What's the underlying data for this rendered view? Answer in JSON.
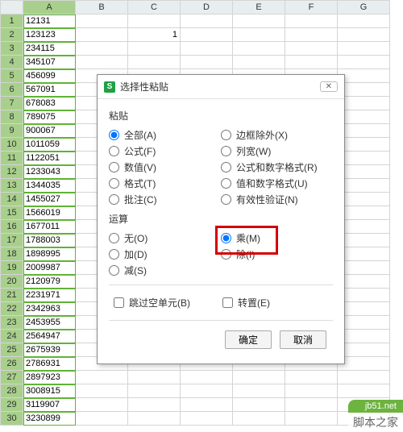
{
  "columns": [
    "A",
    "B",
    "C",
    "D",
    "E",
    "F",
    "G"
  ],
  "rows": [
    {
      "n": 1,
      "a": "12131"
    },
    {
      "n": 2,
      "a": "123123",
      "c": "1"
    },
    {
      "n": 3,
      "a": "234115"
    },
    {
      "n": 4,
      "a": "345107"
    },
    {
      "n": 5,
      "a": "456099"
    },
    {
      "n": 6,
      "a": "567091"
    },
    {
      "n": 7,
      "a": "678083"
    },
    {
      "n": 8,
      "a": "789075"
    },
    {
      "n": 9,
      "a": "900067"
    },
    {
      "n": 10,
      "a": "1011059"
    },
    {
      "n": 11,
      "a": "1122051"
    },
    {
      "n": 12,
      "a": "1233043"
    },
    {
      "n": 13,
      "a": "1344035"
    },
    {
      "n": 14,
      "a": "1455027"
    },
    {
      "n": 15,
      "a": "1566019"
    },
    {
      "n": 16,
      "a": "1677011"
    },
    {
      "n": 17,
      "a": "1788003"
    },
    {
      "n": 18,
      "a": "1898995"
    },
    {
      "n": 19,
      "a": "2009987"
    },
    {
      "n": 20,
      "a": "2120979"
    },
    {
      "n": 21,
      "a": "2231971"
    },
    {
      "n": 22,
      "a": "2342963"
    },
    {
      "n": 23,
      "a": "2453955"
    },
    {
      "n": 24,
      "a": "2564947"
    },
    {
      "n": 25,
      "a": "2675939"
    },
    {
      "n": 26,
      "a": "2786931"
    },
    {
      "n": 27,
      "a": "2897923"
    },
    {
      "n": 28,
      "a": "3008915"
    },
    {
      "n": 29,
      "a": "3119907"
    },
    {
      "n": 30,
      "a": "3230899"
    }
  ],
  "dialog": {
    "title": "选择性粘贴",
    "group_paste": "粘贴",
    "paste_left": [
      {
        "label": "全部(A)",
        "checked": true
      },
      {
        "label": "公式(F)"
      },
      {
        "label": "数值(V)"
      },
      {
        "label": "格式(T)"
      },
      {
        "label": "批注(C)"
      }
    ],
    "paste_right": [
      {
        "label": "边框除外(X)"
      },
      {
        "label": "列宽(W)"
      },
      {
        "label": "公式和数字格式(R)"
      },
      {
        "label": "值和数字格式(U)"
      },
      {
        "label": "有效性验证(N)"
      }
    ],
    "group_op": "运算",
    "op_left": [
      {
        "label": "无(O)"
      },
      {
        "label": "加(D)"
      },
      {
        "label": "减(S)"
      }
    ],
    "op_right": [
      {
        "label": "乘(M)",
        "checked": true
      },
      {
        "label": "除(I)"
      }
    ],
    "skip_blanks": "跳过空单元(B)",
    "transpose": "转置(E)",
    "ok": "确定",
    "cancel": "取消"
  },
  "watermark": {
    "url": "jb51.net",
    "name": "脚本之家"
  }
}
